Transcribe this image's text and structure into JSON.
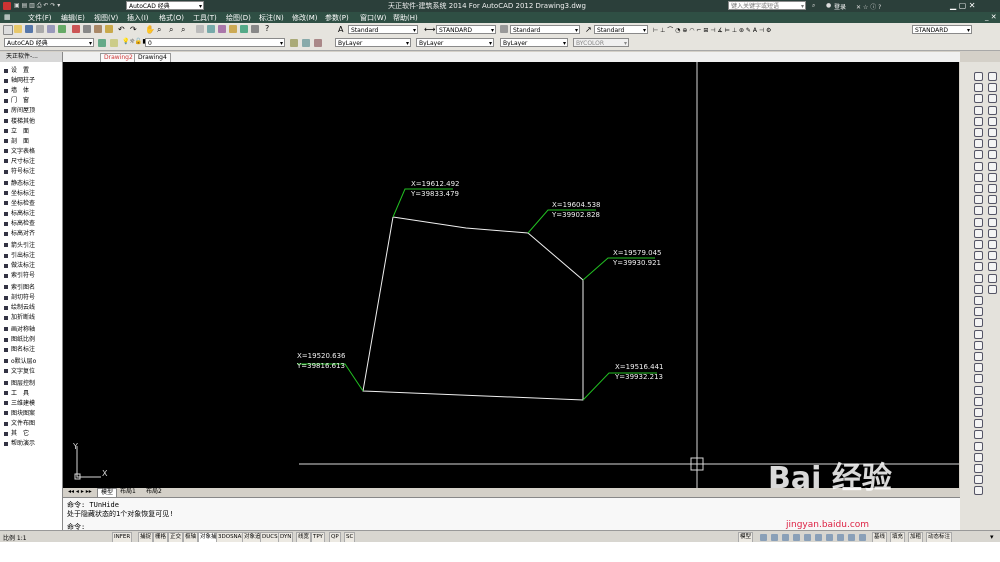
{
  "window": {
    "title": "天正软件-建筑系统 2014  For AutoCAD 2012   Drawing3.dwg",
    "workspace": "AutoCAD 经典",
    "search_placeholder": "键入关键字或短语",
    "login": "登录"
  },
  "menu": [
    "文件(F)",
    "编辑(E)",
    "视图(V)",
    "插入(I)",
    "格式(O)",
    "工具(T)",
    "绘图(D)",
    "标注(N)",
    "修改(M)",
    "参数(P)",
    "窗口(W)",
    "帮助(H)"
  ],
  "toolbar": {
    "workspace_combo": "AutoCAD 经典",
    "layer_value": "0",
    "text_style": "Standard",
    "dim_style": "STANDARD",
    "table_style": "Standard",
    "mleader_style": "Standard",
    "annot_scale": "STANDARD",
    "color": "ByLayer",
    "linetype": "ByLayer",
    "lineweight": "ByLayer",
    "plotstyle": "BYCOLOR"
  },
  "doc_tabs": [
    "Drawing2",
    "Drawing4"
  ],
  "palette": {
    "title": "天正软件-...",
    "items": [
      "设　置",
      "轴网柱子",
      "墙　体",
      "门　窗",
      "房间屋顶",
      "楼梯其他",
      "立　面",
      "剖　面",
      "文字表格",
      "尺寸标注",
      "符号标注",
      "静态标注",
      "坐标标注",
      "坐标检查",
      "标高标注",
      "标高检查",
      "标高对齐",
      "箭头引注",
      "引出标注",
      "做法标注",
      "索引符号",
      "索引图名",
      "剖切符号",
      "绘制云线",
      "加折断线",
      "画对称轴",
      "图纸比例",
      "图名标注",
      "o默认层o",
      "文字复位",
      "图层控制",
      "工　具",
      "三维建模",
      "图块图案",
      "文件布图",
      "其　它",
      "帮助演示"
    ]
  },
  "drawing": {
    "labels": [
      {
        "x": "X=19612.492",
        "y": "Y=39833.479"
      },
      {
        "x": "X=19604.538",
        "y": "Y=39902.828"
      },
      {
        "x": "X=19579.045",
        "y": "Y=39930.921"
      },
      {
        "x": "X=19520.636",
        "y": "Y=39816.613"
      },
      {
        "x": "X=19516.441",
        "y": "Y=39932.213"
      }
    ],
    "ucs_x": "X",
    "ucs_y": "Y"
  },
  "layout_tabs": [
    "模型",
    "布局1",
    "布局2"
  ],
  "command": {
    "line1": "命令: TUnHide",
    "line2": "处于隐藏状态的1个对象恢复可见!",
    "prompt": "命令:"
  },
  "status": {
    "scale": "比例 1:1",
    "toggles": [
      "INFER",
      "捕捉",
      "栅格",
      "正交",
      "极轴",
      "对象捕捉",
      "3DOSNAP",
      "对象追踪",
      "DUCS",
      "DYN",
      "线宽",
      "TPY",
      "QP",
      "SC"
    ],
    "right_items": [
      "模型",
      "基线",
      "填充",
      "加粗",
      "动态标注"
    ]
  },
  "watermark": {
    "brand": "Bai 经验",
    "url": "jingyan.baidu.com"
  },
  "colors": {
    "canvas": "#000000",
    "leader": "#22c022",
    "polyline": "#ffffff",
    "title_bg": "#2b3f3a"
  }
}
